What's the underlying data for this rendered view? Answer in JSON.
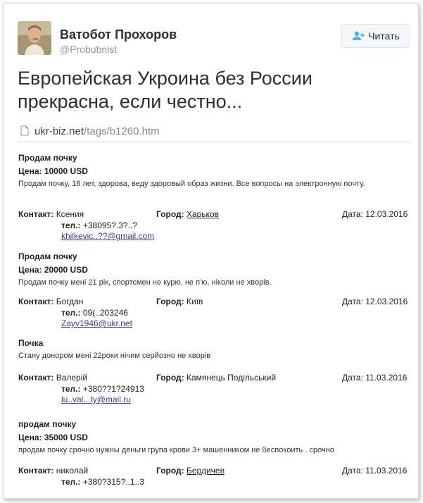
{
  "author": {
    "name": "Ватобот Прохоров",
    "handle": "@Probubnist"
  },
  "follow_button": {
    "label": "Читать"
  },
  "tweet_text": "Европейская Укроина без России прекрасна, если честно...",
  "link": {
    "domain": "ukr-biz.net",
    "path": "/tags/b1260.htm"
  },
  "labels": {
    "contact": "Контакт:",
    "city": "Город:",
    "date": "Дата:",
    "phone": "тел.:"
  },
  "ads": [
    {
      "title": "Продам почку",
      "price": "Цена: 10000 USD",
      "description": "Продам почку, 18 лет, здорова, веду здоровый образ жизни. Все вопросы на электронную почту.",
      "contact": "Ксения",
      "city": "Харьков",
      "date": "12.03.2016",
      "phone": "+38095?.3?..?",
      "email": "khilkevic..??@gmail.com"
    },
    {
      "title": "Продам почку",
      "price": "Цена: 20000 USD",
      "description": "Продам почку мені 21 рік, спортсмен не курю, не п'ю, ніколи не хворів.",
      "contact": "Богдан",
      "city": "Київ",
      "date": "12.03.2016",
      "phone": "09(..203246",
      "email": "Zayv1946@ukr.net"
    },
    {
      "title": "Почка",
      "price": "",
      "description": "Стану донором мені 22роки нічим серйозно не хворів",
      "contact": "Валерій",
      "city": "Камянець Подільський",
      "date": "11.03.2016",
      "phone": "+380??1?24913",
      "email": "lu..val...ty@mail.ru"
    },
    {
      "title": "продам почку",
      "price": "Цена: 35000 USD",
      "description": "продам почку срочно нужны деньги група крови 3+ машенником не беспокоить . срочно",
      "contact": "николай",
      "city": "Бердичев",
      "date": "11.03.2016",
      "phone": "+380?315?..1..3",
      "email": ""
    }
  ]
}
